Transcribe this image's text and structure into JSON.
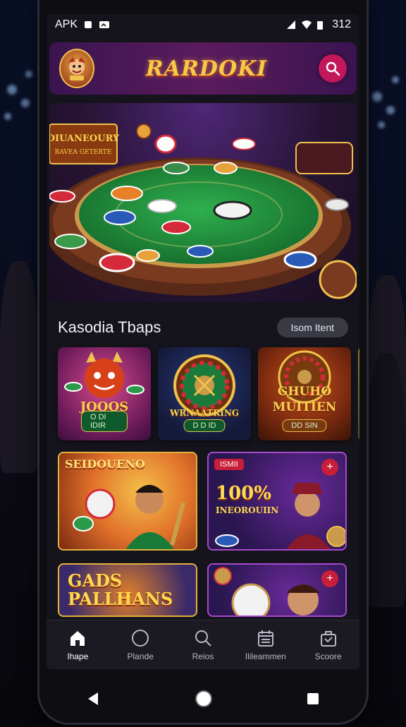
{
  "statusbar": {
    "left_text": "APK",
    "time": "312"
  },
  "header": {
    "logo_text": "RARDOKI",
    "mascot_label": "RARDOKI"
  },
  "hero": {
    "sign_line1": "DIUANEOURY",
    "sign_line2": "RAVEA GETERTE"
  },
  "section": {
    "title": "Kasodia Tbaps",
    "pill": "Isom Itent"
  },
  "row1": [
    {
      "title": "JOOOS",
      "badge": "O DI IDIR"
    },
    {
      "title": "WRNAATRING",
      "badge": "D D ID"
    },
    {
      "title": "GHUHO MUITIEN",
      "badge": "DD SIN"
    }
  ],
  "row2": [
    {
      "title": "SEIDOUENO"
    },
    {
      "tag": "ISMII",
      "main": "100%",
      "sub": "INEOROUIIN"
    }
  ],
  "row3": [
    {
      "title": "GADS PALLHANS"
    }
  ],
  "tabs": [
    {
      "label": "Ihape",
      "icon": "home-icon"
    },
    {
      "label": "Plande",
      "icon": "circle-icon"
    },
    {
      "label": "Reios",
      "icon": "search-icon"
    },
    {
      "label": "Ilileammen",
      "icon": "calendar-icon"
    },
    {
      "label": "Scoore",
      "icon": "bag-icon"
    }
  ],
  "colors": {
    "accent": "#c2185b",
    "header": "#5a1b5e",
    "table": "#1f8a3c",
    "gold": "#f7c948"
  }
}
